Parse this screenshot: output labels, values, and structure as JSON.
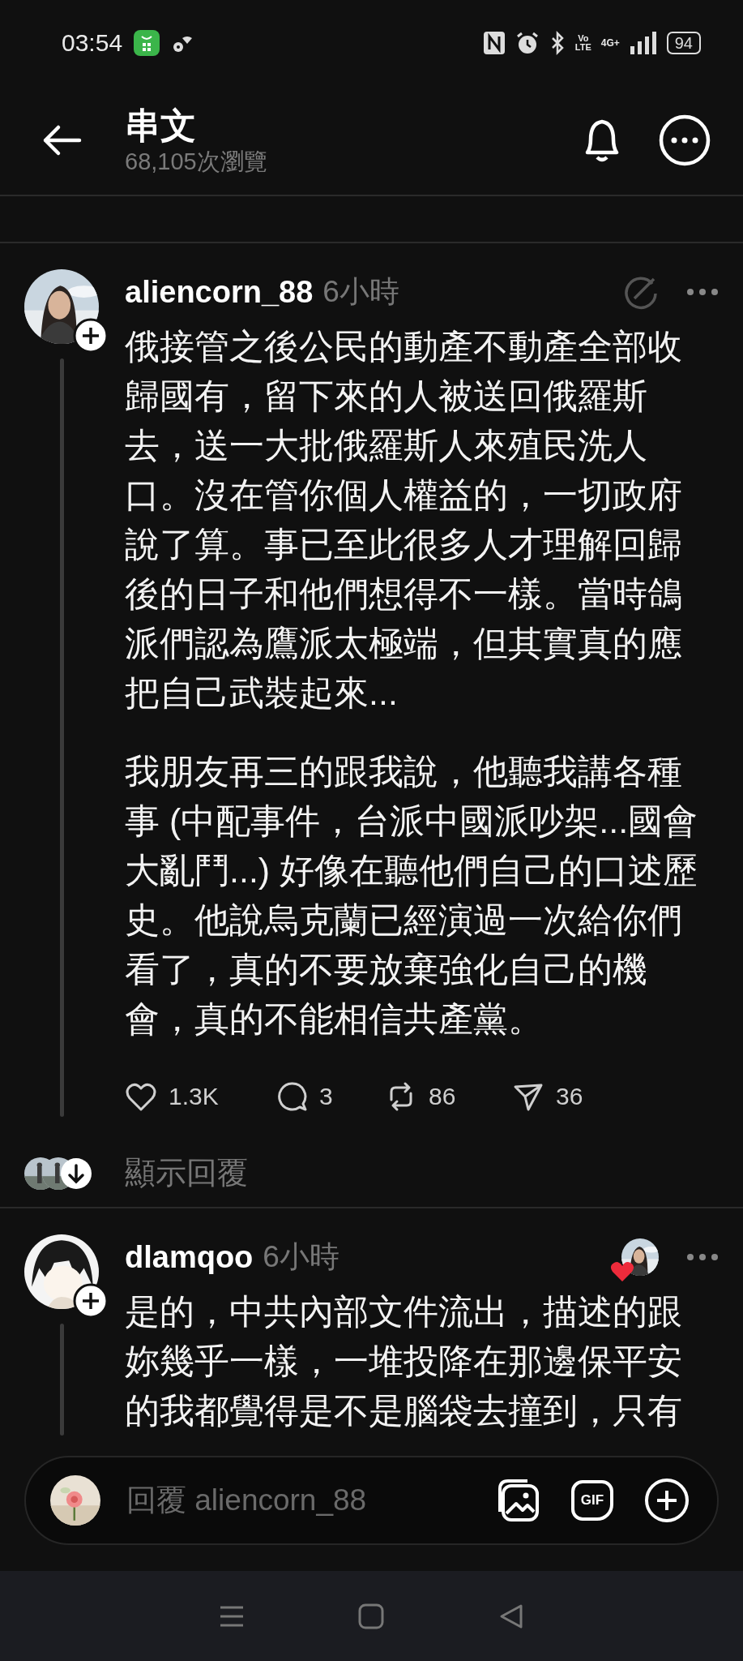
{
  "status_bar": {
    "time": "03:54",
    "network_labels": [
      "Vo",
      "LTE",
      "4G+"
    ],
    "battery": "94"
  },
  "header": {
    "title": "串文",
    "views": "68,105次瀏覽"
  },
  "posts": [
    {
      "username": "aliencorn_88",
      "time": "6小時",
      "author_liked": false,
      "paragraphs": [
        "俄接管之後公民的動產不動產全部收歸國有，留下來的人被送回俄羅斯去，送一大批俄羅斯人來殖民洗人口。沒在管你個人權益的，一切政府說了算。事已至此很多人才理解回歸後的日子和他們想得不一樣。當時鴿派們認為鷹派太極端，但其實真的應把自己武裝起來...",
        "我朋友再三的跟我說，他聽我講各種事 (中配事件，台派中國派吵架...國會大亂鬥...) 好像在聽他們自己的口述歷史。他說烏克蘭已經演過一次給你們看了，真的不要放棄強化自己的機會，真的不能相信共產黨。"
      ],
      "actions": {
        "likes": "1.3K",
        "comments": "3",
        "reposts": "86",
        "shares": "36"
      },
      "show_replies": "顯示回覆"
    },
    {
      "username": "dlamqoo",
      "time": "6小時",
      "author_liked": true,
      "paragraphs": [
        "是的，中共內部文件流出，描述的跟妳幾乎一樣，一堆投降在那邊保平安的我都覺得是不是腦袋去撞到，只有"
      ]
    }
  ],
  "reply_bar": {
    "placeholder": "回覆 aliencorn_88",
    "gif_label": "GIF"
  }
}
